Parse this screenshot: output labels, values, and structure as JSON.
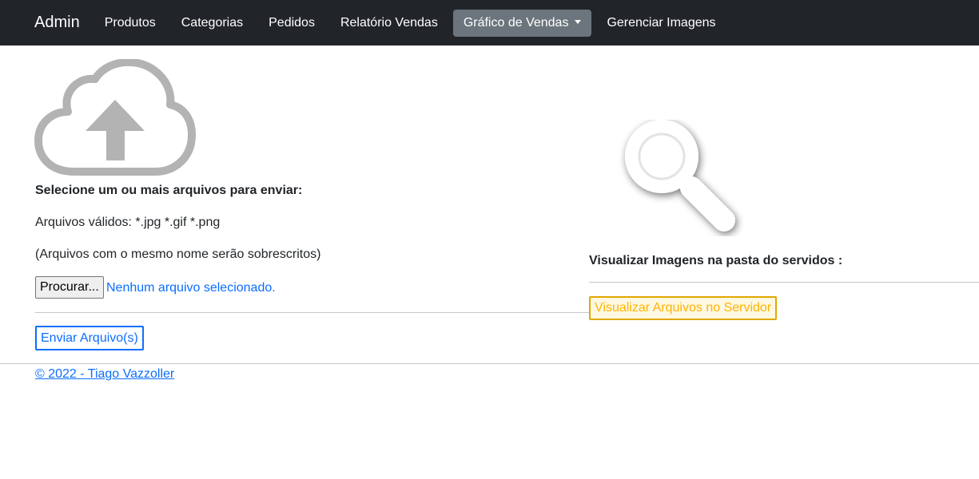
{
  "navbar": {
    "brand": "Admin",
    "items": [
      {
        "label": "Produtos"
      },
      {
        "label": "Categorias"
      },
      {
        "label": "Pedidos"
      },
      {
        "label": "Relatório Vendas"
      },
      {
        "label": "Gráfico de Vendas",
        "active": true,
        "dropdown": true
      },
      {
        "label": "Gerenciar Imagens"
      }
    ]
  },
  "upload": {
    "icon": "cloud-upload-icon",
    "heading": "Selecione um ou mais arquivos para enviar:",
    "valid_files": "Arquivos válidos: *.jpg *.gif *.png",
    "overwrite_note": "(Arquivos com o mesmo nome serão sobrescritos)",
    "browse_label": "Procurar...",
    "no_file_text": "Nenhum arquivo selecionado.",
    "send_label": "Enviar Arquivo(s)"
  },
  "viewer": {
    "icon": "magnifier-icon",
    "heading": "Visualizar Imagens na pasta do servidos :",
    "button_label": "Visualizar Arquivos no Servidor"
  },
  "footer": {
    "text": "© 2022 - Tiago Vazzoller"
  },
  "colors": {
    "navbar_bg": "#212529",
    "active_nav_bg": "#6c757d",
    "primary": "#0d6efd",
    "warning": "#ffb300"
  }
}
